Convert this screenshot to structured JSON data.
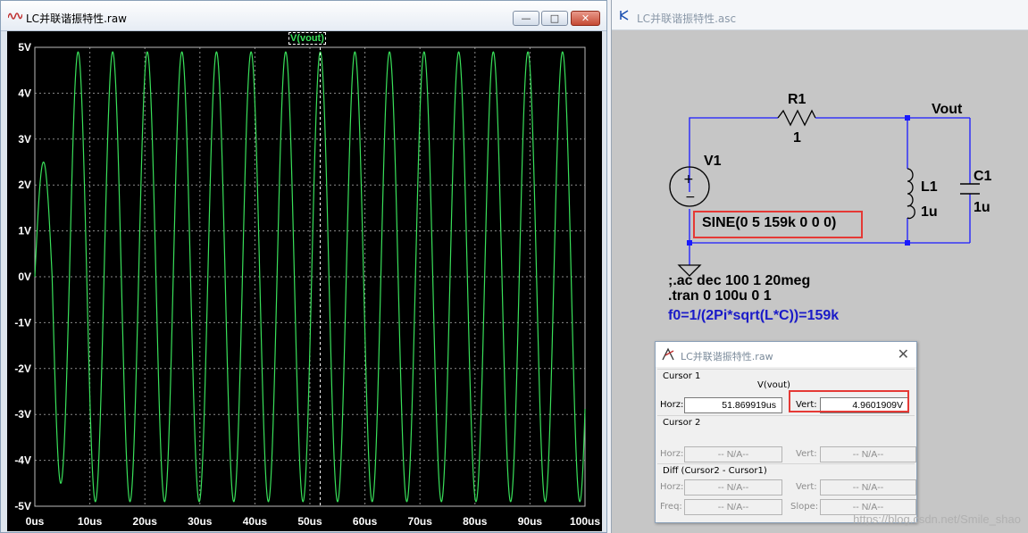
{
  "waveform_window": {
    "title": "LC并联谐振特性.raw",
    "buttons": {
      "minimize": "—",
      "maximize": "□",
      "close": "✕"
    },
    "trace_label": "V(vout)"
  },
  "chart_data": {
    "type": "line",
    "title": "",
    "series": [
      {
        "name": "V(vout)",
        "color": "#39e05a",
        "amplitude": 4.9,
        "frequency_hz": 159000,
        "first_peak": 2.5,
        "first_trough": -4.5
      }
    ],
    "x_range_us": [
      0,
      100
    ],
    "y_range_v": [
      -5,
      5
    ],
    "x_ticks": [
      "0us",
      "10us",
      "20us",
      "30us",
      "40us",
      "50us",
      "60us",
      "70us",
      "80us",
      "90us",
      "100us"
    ],
    "y_ticks": [
      "5V",
      "4V",
      "3V",
      "2V",
      "1V",
      "0V",
      "-1V",
      "-2V",
      "-3V",
      "-4V",
      "-5V"
    ],
    "grid": true,
    "cursor_x_us": 51.869919,
    "background": "#000000"
  },
  "schematic_window": {
    "title": "LC并联谐振特性.asc",
    "labels": {
      "r1_name": "R1",
      "r1_value": "1",
      "net_vout": "Vout",
      "v1_name": "V1",
      "v1_value": "SINE(0 5 159k 0 0 0)",
      "l1_name": "L1",
      "l1_value": "1u",
      "c1_name": "C1",
      "c1_value": "1u"
    },
    "directives": {
      "ac": ";.ac dec 100 1 20meg",
      "tran": ".tran 0 100u 0 1",
      "f0": "f0=1/(2Pi*sqrt(L*C))=159k"
    }
  },
  "cursor_dialog": {
    "title": "LC并联谐振特性.raw",
    "cursor1_label": "Cursor 1",
    "trace": "V(vout)",
    "horz_label": "Horz:",
    "horz_value": "51.869919us",
    "vert_label": "Vert:",
    "vert_value": "4.9601909V",
    "cursor2_label": "Cursor 2",
    "cursor2_horz": "-- N/A--",
    "cursor2_vert": "-- N/A--",
    "diff_label": "Diff (Cursor2 - Cursor1)",
    "diff_horz": "-- N/A--",
    "diff_vert": "-- N/A--",
    "freq_label": "Freq:",
    "diff_freq": "-- N/A--",
    "slope_label": "Slope:",
    "diff_slope": "-- N/A--"
  },
  "watermark": "https://blog.csdn.net/Smile_shao"
}
